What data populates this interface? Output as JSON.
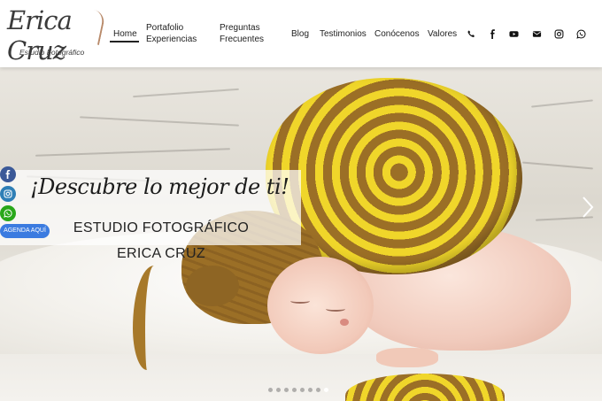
{
  "brand": {
    "logo_script": "Erica Cruz",
    "logo_sub": "Estudio Fotográfico"
  },
  "nav": {
    "home": "Home",
    "portfolio_line1": "Portafolio",
    "portfolio_line2": "Experiencias",
    "faq_line1": "Preguntas",
    "faq_line2": "Frecuentes",
    "blog": "Blog",
    "testimonios": "Testimonios",
    "conocenos": "Conócenos",
    "valores": "Valores"
  },
  "social_icons": [
    "phone-icon",
    "facebook-icon",
    "youtube-icon",
    "mail-icon",
    "instagram-icon",
    "whatsapp-icon"
  ],
  "hero": {
    "tagline": "¡Descubre lo mejor de ti!",
    "studio_line1": "ESTUDIO FOTOGRÁFICO",
    "studio_line2": "ERICA CRUZ"
  },
  "side_bar": {
    "icons": [
      "facebook-icon",
      "instagram-icon",
      "whatsapp-icon"
    ],
    "agenda_label": "AGENDA AQUÍ"
  },
  "slider": {
    "slide_count": 8,
    "active_slide": 7
  },
  "colors": {
    "facebook": "#3b5998",
    "instagram": "#2f7fb6",
    "whatsapp": "#29a71a",
    "agenda_button": "#3b7be0",
    "hat_yellow": "#f0d62a",
    "hat_brown": "#9b6f26"
  }
}
